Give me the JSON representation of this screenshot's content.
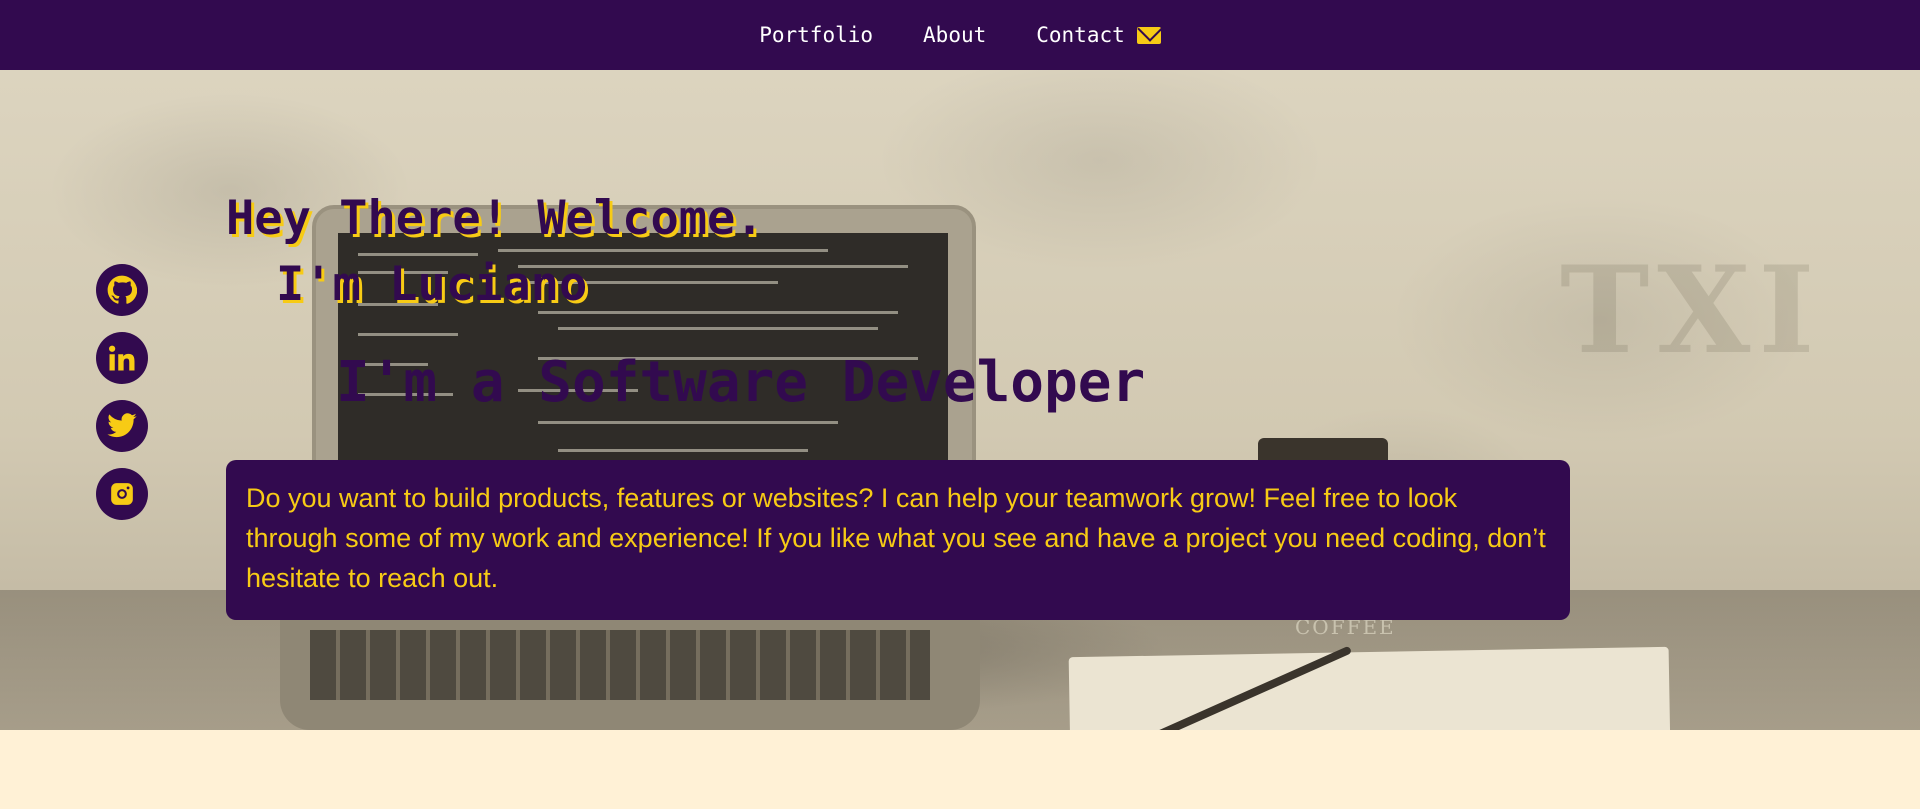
{
  "nav": {
    "items": [
      {
        "label": "Portfolio"
      },
      {
        "label": "About"
      },
      {
        "label": "Contact"
      }
    ],
    "contact_icon": "envelope-icon"
  },
  "hero": {
    "greeting": "Hey There! Welcome.",
    "name_line": "I'm Luciano",
    "role_line": "I'm a Software Developer",
    "intro": "Do you want to build products, features or websites? I can help your teamwork grow! Feel free to look through some of my work and experience! If you like what you see and have a project you need coding, don’t hesitate to reach out.",
    "background_cup_label": "COFFEE"
  },
  "social": [
    {
      "icon": "github-icon"
    },
    {
      "icon": "linkedin-icon"
    },
    {
      "icon": "twitter-icon"
    },
    {
      "icon": "instagram-icon"
    }
  ],
  "colors": {
    "primary": "#320a4f",
    "accent": "#f7cb15",
    "page_background": "#fff1d6",
    "nav_text": "#ffffff"
  }
}
